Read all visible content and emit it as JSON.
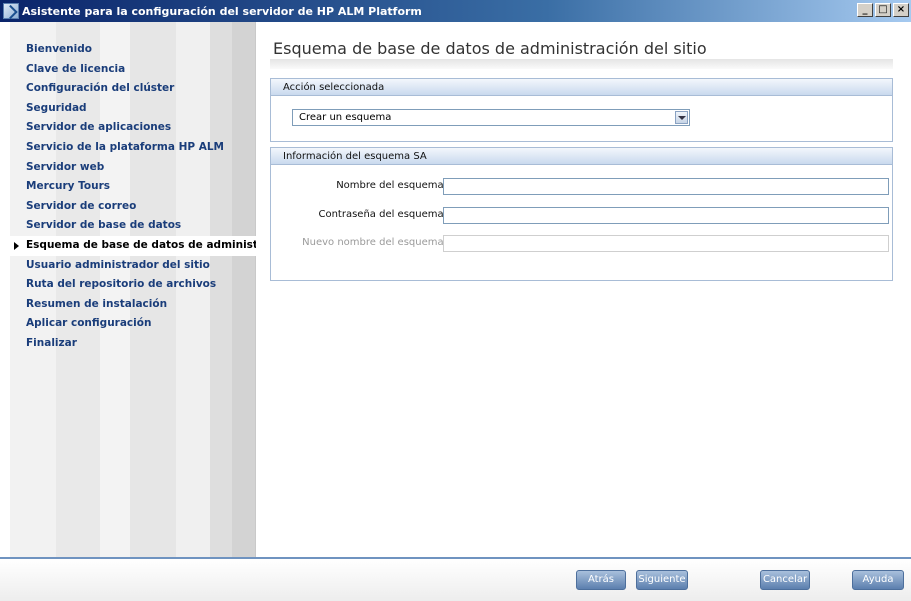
{
  "window": {
    "title": "Asistente para la configuración del servidor de HP ALM Platform",
    "controls": [
      "_",
      "□",
      "×"
    ]
  },
  "sidebar": {
    "items": [
      {
        "label": "Bienvenido",
        "active": false
      },
      {
        "label": "Clave de licencia",
        "active": false
      },
      {
        "label": "Configuración del clúster",
        "active": false
      },
      {
        "label": "Seguridad",
        "active": false
      },
      {
        "label": "Servidor de aplicaciones",
        "active": false
      },
      {
        "label": "Servicio de la plataforma HP ALM",
        "active": false
      },
      {
        "label": "Servidor web",
        "active": false
      },
      {
        "label": "Mercury Tours",
        "active": false
      },
      {
        "label": "Servidor de correo",
        "active": false
      },
      {
        "label": "Servidor de base de datos",
        "active": false
      },
      {
        "label": "Esquema de base de datos de administrac",
        "active": true
      },
      {
        "label": "Usuario administrador del sitio",
        "active": false
      },
      {
        "label": "Ruta del repositorio de archivos",
        "active": false
      },
      {
        "label": "Resumen de instalación",
        "active": false
      },
      {
        "label": "Aplicar configuración",
        "active": false
      },
      {
        "label": "Finalizar",
        "active": false
      }
    ]
  },
  "main": {
    "title": "Esquema de base de datos de administración del sitio",
    "action_panel": {
      "header": "Acción seleccionada",
      "selected": "Crear un esquema"
    },
    "schema_panel": {
      "header": "Información del esquema SA",
      "fields": [
        {
          "label": "Nombre del esquema:",
          "value": "",
          "disabled": false
        },
        {
          "label": "Contraseña del esquema:",
          "value": "",
          "disabled": false
        },
        {
          "label": "Nuevo nombre del esquema:",
          "value": "",
          "disabled": true
        }
      ]
    }
  },
  "footer": {
    "back": "Atrás",
    "next": "Siguiente",
    "cancel": "Cancelar",
    "help": "Ayuda"
  }
}
